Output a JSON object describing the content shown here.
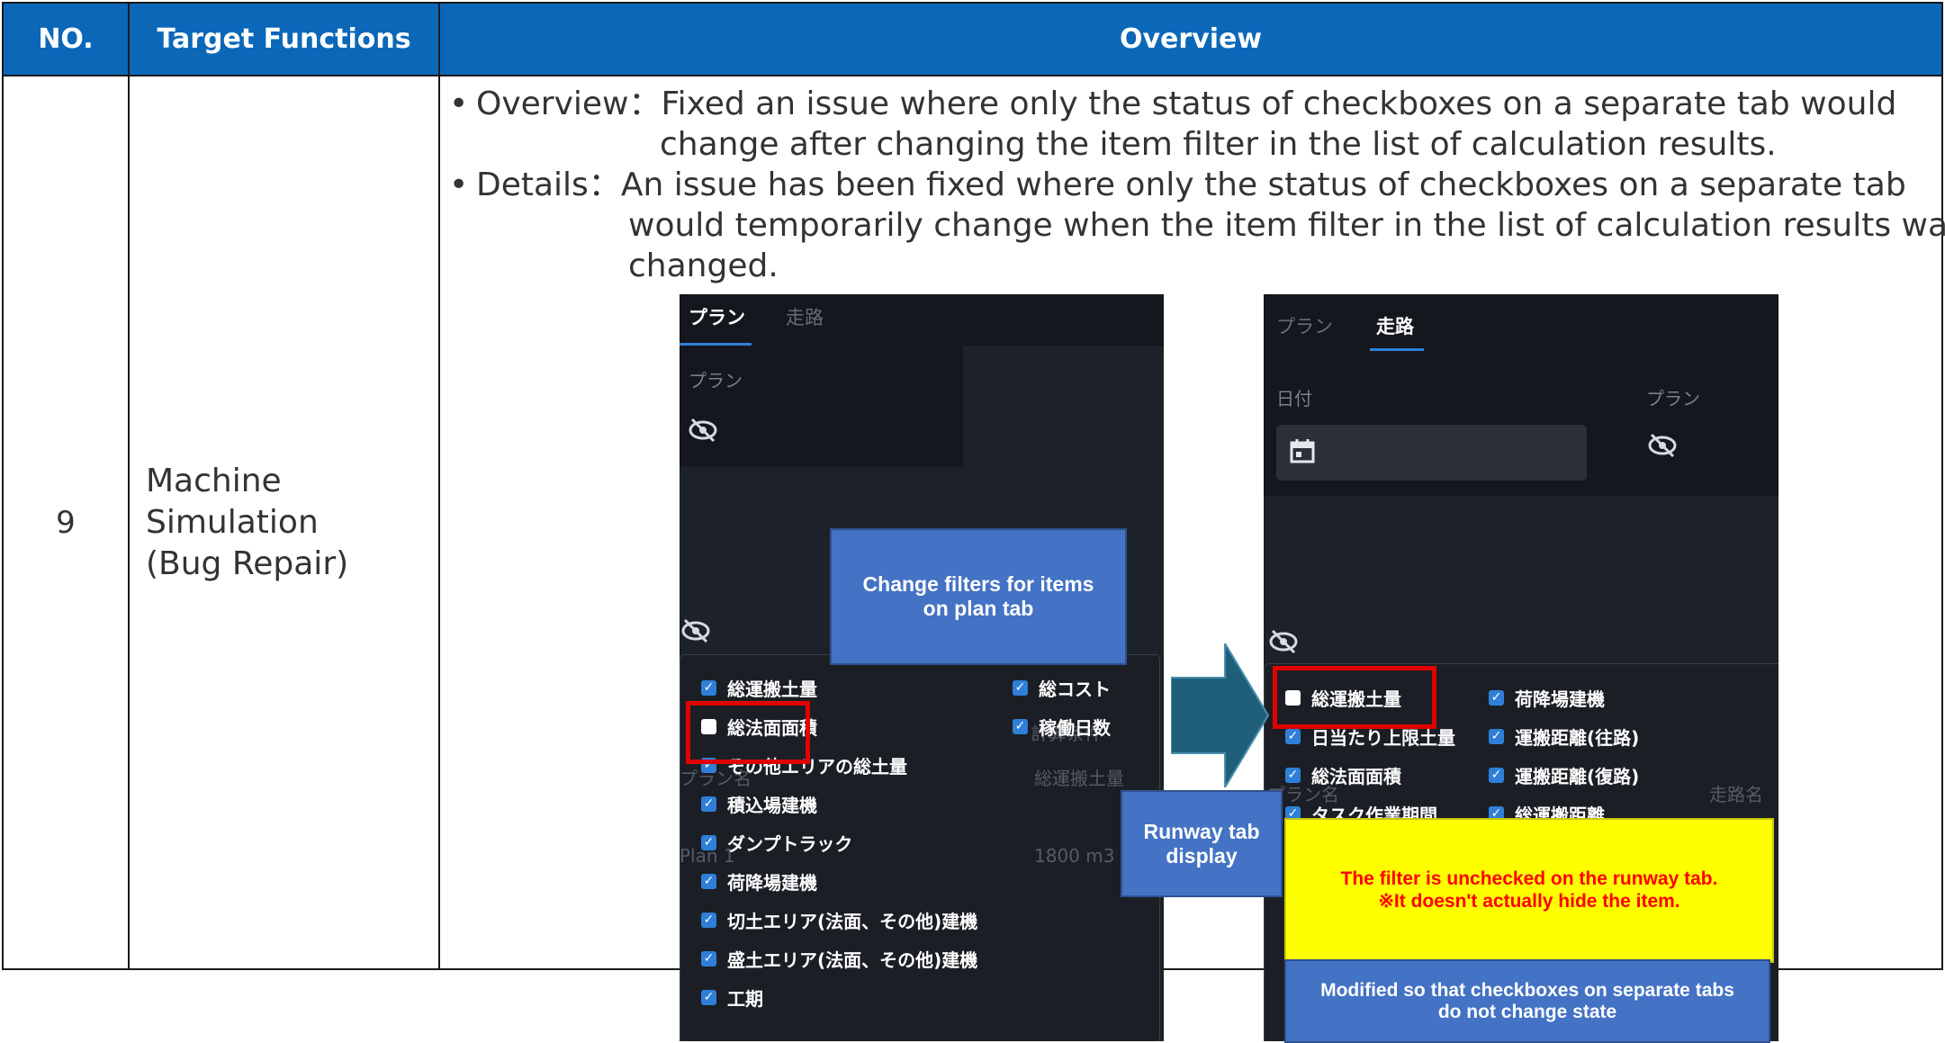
{
  "header": {
    "no": "NO.",
    "target_functions": "Target Functions",
    "overview": "Overview"
  },
  "row": {
    "no": "9",
    "target_lines": [
      "Machine",
      "Simulation",
      "(Bug Repair)"
    ],
    "overview_label": "Overview：",
    "overview_line1": "Fixed an issue where only the status of checkboxes on a separate tab would",
    "overview_line2": "change after changing the item filter in the list of calculation results.",
    "details_label": "Details：",
    "details_line1": "An issue has been fixed where only the status of checkboxes on a separate tab",
    "details_line2": "would temporarily change when the item filter in the list of calculation results was",
    "details_line3": "changed."
  },
  "left_shot": {
    "tab_plan": "プラン",
    "tab_runway": "走路",
    "label_plan": "プラン",
    "bg_calc": "計算条件",
    "bg_plan_name": "プラン名",
    "bg_total": "総運搬土量",
    "bg_plan1": "Plan 1",
    "bg_1800": "1800 m3",
    "items_left": [
      {
        "label": "総運搬土量",
        "checked": true
      },
      {
        "label": "総法面面積",
        "checked": false
      },
      {
        "label": "その他エリアの総土量",
        "checked": true
      },
      {
        "label": "積込場建機",
        "checked": true
      },
      {
        "label": "ダンプトラック",
        "checked": true
      },
      {
        "label": "荷降場建機",
        "checked": true
      },
      {
        "label": "切土エリア(法面、その他)建機",
        "checked": true
      },
      {
        "label": "盛土エリア(法面、その他)建機",
        "checked": true
      },
      {
        "label": "工期",
        "checked": true
      }
    ],
    "items_right": [
      {
        "label": "総コスト",
        "checked": true
      },
      {
        "label": "稼働日数",
        "checked": true
      }
    ]
  },
  "right_shot": {
    "tab_plan": "プラン",
    "tab_runway": "走路",
    "label_date": "日付",
    "label_plan": "プラン",
    "bg_plan_name": "プラン名",
    "bg_runway_name": "走路名",
    "items_left": [
      {
        "label": "総運搬土量",
        "checked": false
      },
      {
        "label": "日当たり上限土量",
        "checked": true
      },
      {
        "label": "総法面面積",
        "checked": true
      },
      {
        "label": "タスク作業期間",
        "checked": true
      }
    ],
    "items_right": [
      {
        "label": "荷降場建機",
        "checked": true
      },
      {
        "label": "運搬距離(往路)",
        "checked": true
      },
      {
        "label": "運搬距離(復路)",
        "checked": true
      },
      {
        "label": "総運搬距離",
        "checked": true
      }
    ]
  },
  "callouts": {
    "change_filters": "Change filters for items on plan tab",
    "runway_display": "Runway tab display",
    "unchecked_line1": "The filter is unchecked on the runway tab.",
    "unchecked_line2": "※It doesn't actually hide the item.",
    "modified": "Modified so that checkboxes on separate tabs do not change state"
  },
  "colors": {
    "header_bg": "#0b67b8",
    "callout_blue": "#4472c4",
    "arrow": "#1f5f7a",
    "highlight": "#ffff00",
    "alert_red": "#ff0000"
  },
  "icons": [
    "eye-off-icon",
    "calendar-icon",
    "checkbox-icon",
    "right-arrow-icon"
  ]
}
